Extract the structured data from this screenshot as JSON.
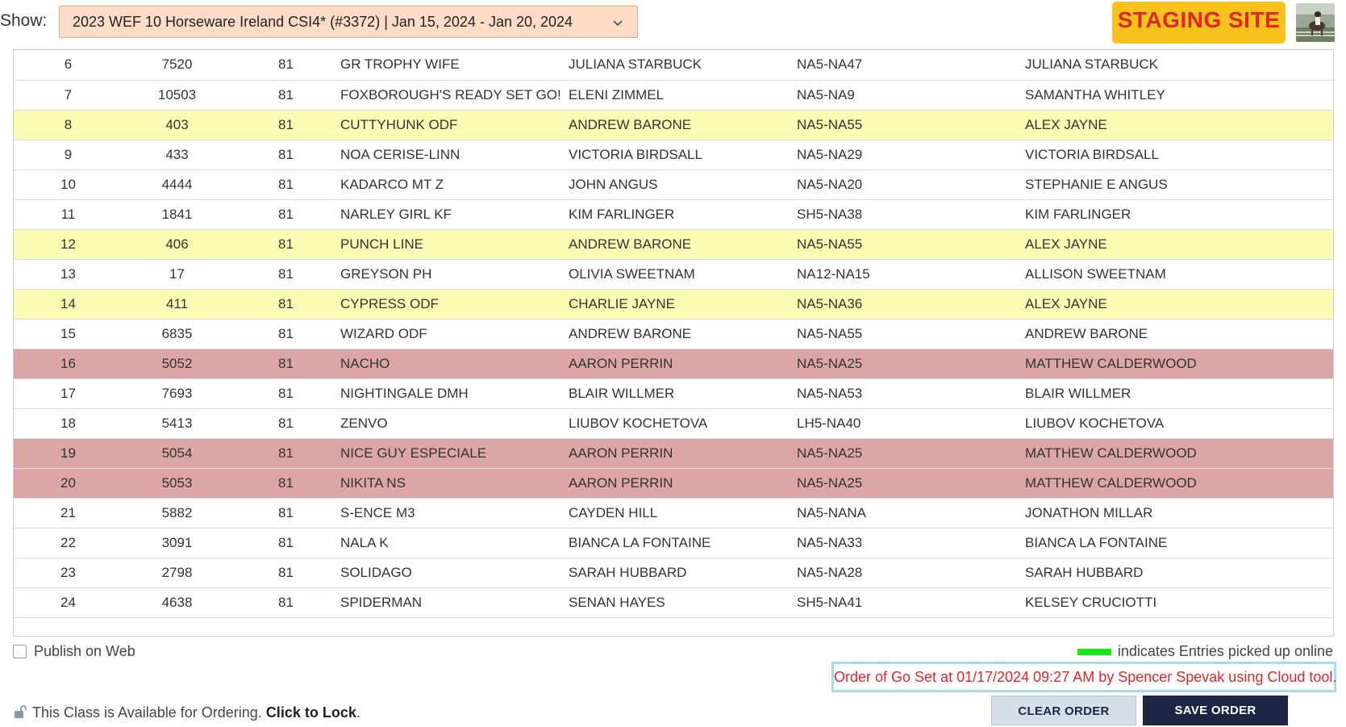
{
  "header": {
    "show_label": "Show:",
    "show_value": "2023 WEF 10 Horseware Ireland CSI4* (#3372) | Jan 15, 2024 - Jan 20, 2024",
    "staging_label": "STAGING SITE"
  },
  "colors": {
    "show_select_bg": "#fddcc7",
    "staging_bg": "#f7c21b",
    "staging_text": "#e0262b",
    "row_highlight_yellow": "#fbfbb3",
    "row_highlight_red": "#dca6a6",
    "online_indicator": "#19e619",
    "save_button": "#1c2541"
  },
  "rows": [
    {
      "order": "6",
      "entry": "7520",
      "class": "81",
      "horse": "GR TROPHY WIFE",
      "rider": "JULIANA STARBUCK",
      "stall": "NA5-NA47",
      "owner": "JULIANA STARBUCK",
      "highlight": ""
    },
    {
      "order": "7",
      "entry": "10503",
      "class": "81",
      "horse": "FOXBOROUGH'S READY SET GO!",
      "rider": "ELENI ZIMMEL",
      "stall": "NA5-NA9",
      "owner": "SAMANTHA WHITLEY",
      "highlight": ""
    },
    {
      "order": "8",
      "entry": "403",
      "class": "81",
      "horse": "CUTTYHUNK ODF",
      "rider": "ANDREW BARONE",
      "stall": "NA5-NA55",
      "owner": "ALEX JAYNE",
      "highlight": "yellow"
    },
    {
      "order": "9",
      "entry": "433",
      "class": "81",
      "horse": "NOA CERISE-LINN",
      "rider": "VICTORIA BIRDSALL",
      "stall": "NA5-NA29",
      "owner": "VICTORIA BIRDSALL",
      "highlight": ""
    },
    {
      "order": "10",
      "entry": "4444",
      "class": "81",
      "horse": "KADARCO MT Z",
      "rider": "JOHN ANGUS",
      "stall": "NA5-NA20",
      "owner": "STEPHANIE E ANGUS",
      "highlight": ""
    },
    {
      "order": "11",
      "entry": "1841",
      "class": "81",
      "horse": "NARLEY GIRL KF",
      "rider": "KIM FARLINGER",
      "stall": "SH5-NA38",
      "owner": "KIM FARLINGER",
      "highlight": ""
    },
    {
      "order": "12",
      "entry": "406",
      "class": "81",
      "horse": "PUNCH LINE",
      "rider": "ANDREW BARONE",
      "stall": "NA5-NA55",
      "owner": "ALEX JAYNE",
      "highlight": "yellow"
    },
    {
      "order": "13",
      "entry": "17",
      "class": "81",
      "horse": "GREYSON PH",
      "rider": "OLIVIA SWEETNAM",
      "stall": "NA12-NA15",
      "owner": "ALLISON SWEETNAM",
      "highlight": ""
    },
    {
      "order": "14",
      "entry": "411",
      "class": "81",
      "horse": "CYPRESS ODF",
      "rider": "CHARLIE JAYNE",
      "stall": "NA5-NA36",
      "owner": "ALEX JAYNE",
      "highlight": "yellow"
    },
    {
      "order": "15",
      "entry": "6835",
      "class": "81",
      "horse": "WIZARD ODF",
      "rider": "ANDREW BARONE",
      "stall": "NA5-NA55",
      "owner": "ANDREW BARONE",
      "highlight": ""
    },
    {
      "order": "16",
      "entry": "5052",
      "class": "81",
      "horse": "NACHO",
      "rider": "AARON PERRIN",
      "stall": "NA5-NA25",
      "owner": "MATTHEW CALDERWOOD",
      "highlight": "red"
    },
    {
      "order": "17",
      "entry": "7693",
      "class": "81",
      "horse": "NIGHTINGALE DMH",
      "rider": "BLAIR WILLMER",
      "stall": "NA5-NA53",
      "owner": "BLAIR WILLMER",
      "highlight": ""
    },
    {
      "order": "18",
      "entry": "5413",
      "class": "81",
      "horse": "ZENVO",
      "rider": "LIUBOV KOCHETOVA",
      "stall": "LH5-NA40",
      "owner": "LIUBOV KOCHETOVA",
      "highlight": ""
    },
    {
      "order": "19",
      "entry": "5054",
      "class": "81",
      "horse": "NICE GUY ESPECIALE",
      "rider": "AARON PERRIN",
      "stall": "NA5-NA25",
      "owner": "MATTHEW CALDERWOOD",
      "highlight": "red"
    },
    {
      "order": "20",
      "entry": "5053",
      "class": "81",
      "horse": "NIKITA NS",
      "rider": "AARON PERRIN",
      "stall": "NA5-NA25",
      "owner": "MATTHEW CALDERWOOD",
      "highlight": "red"
    },
    {
      "order": "21",
      "entry": "5882",
      "class": "81",
      "horse": "S-ENCE M3",
      "rider": "CAYDEN HILL",
      "stall": "NA5-NANA",
      "owner": "JONATHON MILLAR",
      "highlight": ""
    },
    {
      "order": "22",
      "entry": "3091",
      "class": "81",
      "horse": "NALA K",
      "rider": "BIANCA LA FONTAINE",
      "stall": "NA5-NA33",
      "owner": "BIANCA LA FONTAINE",
      "highlight": ""
    },
    {
      "order": "23",
      "entry": "2798",
      "class": "81",
      "horse": "SOLIDAGO",
      "rider": "SARAH HUBBARD",
      "stall": "NA5-NA28",
      "owner": "SARAH HUBBARD",
      "highlight": ""
    },
    {
      "order": "24",
      "entry": "4638",
      "class": "81",
      "horse": "SPIDERMAN",
      "rider": "SENAN HAYES",
      "stall": "SH5-NA41",
      "owner": "KELSEY CRUCIOTTI",
      "highlight": ""
    }
  ],
  "footer": {
    "publish_label": "Publish on Web",
    "publish_checked": false,
    "legend_text": "indicates Entries picked up online",
    "order_note": "Order of Go Set at 01/17/2024 09:27 AM by Spencer Spevak using Cloud tool.",
    "lock_text": "This Class is Available for Ordering.",
    "lock_link": "Click to Lock",
    "lock_period": ".",
    "clear_button": "CLEAR ORDER",
    "save_button": "SAVE ORDER"
  }
}
